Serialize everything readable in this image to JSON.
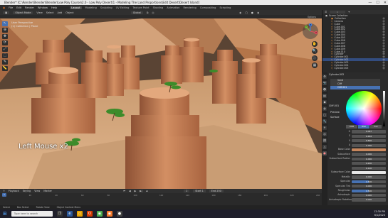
{
  "window": {
    "title": "Blender* [C:\\Render\\Blender\\Blender\\Low Poly Course\\2.0 - Low Poly Desert\\1 - Modeling The Land Proportions\\Edit Desert\\Desert Island]",
    "controls": [
      "—",
      "☐",
      "✕"
    ]
  },
  "menubar": {
    "menus": [
      "File",
      "Edit",
      "Render",
      "Window",
      "Help"
    ],
    "workspaces": [
      "Layout",
      "Modeling",
      "Sculpting",
      "UV Editing",
      "Texture Paint",
      "Shading",
      "Animation",
      "Rendering",
      "Compositing",
      "Scripting"
    ],
    "active_workspace": "Layout"
  },
  "viewport_header": {
    "mode": "Object Mode",
    "menus": [
      "View",
      "Select",
      "Add",
      "Object"
    ],
    "orientation": "Global"
  },
  "viewport_header2": {
    "items": [
      "Options"
    ]
  },
  "viewport": {
    "perspective": "User Perspective",
    "collection": "(1) Collection | Plane",
    "overlay_text": "Left Mouse x2",
    "tools": [
      "↖",
      "⊕",
      "✥",
      "⟳",
      "⤢",
      "⬚",
      "✎",
      "📏"
    ],
    "nav_buttons": [
      "✋",
      "🔍",
      "🎥",
      "▦"
    ],
    "gizmo_axes": [
      "X",
      "Y",
      "Z"
    ],
    "colors": {
      "sand": "#d8a578",
      "sky": "#4a3b30",
      "rock": "#c8875d",
      "tree": "#3c8b2a"
    }
  },
  "outliner": {
    "header": [
      "Scene Collection"
    ],
    "rows": [
      {
        "name": "Collection",
        "sel": false
      },
      {
        "name": "Camera",
        "sel": false
      },
      {
        "name": "Cube",
        "sel": false
      },
      {
        "name": "Cube.001",
        "sel": false
      },
      {
        "name": "Cube.002",
        "sel": false
      },
      {
        "name": "Cube.003",
        "sel": false
      },
      {
        "name": "Cube.004",
        "sel": false
      },
      {
        "name": "Cube.005",
        "sel": false
      },
      {
        "name": "Cube.006",
        "sel": false
      },
      {
        "name": "Cube.007",
        "sel": false
      },
      {
        "name": "Cube.008",
        "sel": false
      },
      {
        "name": "Cube.009",
        "sel": false
      },
      {
        "name": "Cube.010",
        "sel": false
      },
      {
        "name": "Cylinder",
        "sel": false
      },
      {
        "name": "Cylinder.001",
        "sel": false
      },
      {
        "name": "Cylinder.002",
        "sel": true
      },
      {
        "name": "Cylinder.003",
        "sel": false
      },
      {
        "name": "Cylinder.004",
        "sel": false
      },
      {
        "name": "Cylinder.005",
        "sel": false
      }
    ]
  },
  "properties": {
    "object_name": "Cylinder.002",
    "material_slots": [
      "Sand",
      "Cliff",
      "Cliff.001"
    ],
    "selected_slot": "Cliff.001",
    "material_name": "Cliff.001",
    "sections": [
      "Preview",
      "Surface"
    ],
    "color_modes": [
      "RGB",
      "HSV",
      "Hex"
    ],
    "active_color_mode": "HSV",
    "fields": [
      {
        "label": "H",
        "value": "0.067"
      },
      {
        "label": "S",
        "value": "0.482"
      },
      {
        "label": "V",
        "value": "0.800"
      },
      {
        "label": "A",
        "value": "1.000"
      },
      {
        "label": "Base Color",
        "value": ""
      },
      {
        "label": "Subsurface",
        "value": "0.000"
      },
      {
        "label": "Subsurface Radius",
        "value": "1.000"
      },
      {
        "label": "",
        "value": "0.200"
      },
      {
        "label": "",
        "value": "0.100"
      },
      {
        "label": "Subsurface Color",
        "value": ""
      },
      {
        "label": "Metallic",
        "value": "0.000"
      },
      {
        "label": "Specular",
        "value": "0.500"
      },
      {
        "label": "Specular Tint",
        "value": "0.000"
      },
      {
        "label": "Roughness",
        "value": "0.500"
      },
      {
        "label": "Anisotropic",
        "value": "0.000"
      },
      {
        "label": "Anisotropic Rotation",
        "value": "0.000"
      }
    ]
  },
  "timeline": {
    "menus": [
      "Playback",
      "Keying",
      "View",
      "Marker"
    ],
    "current_frame": "1",
    "start": "Start 1",
    "end": "End 250",
    "ticks": [
      "0",
      "20",
      "40",
      "60",
      "80",
      "100",
      "120",
      "140",
      "160",
      "180",
      "200",
      "220",
      "240"
    ]
  },
  "statusbar": {
    "items": [
      "Select",
      "Box Select",
      "Rotate View",
      "Object Context Menu"
    ]
  },
  "taskbar": {
    "search_placeholder": "Type here to search",
    "time": "12:30 PM",
    "date": "6/1/2020"
  }
}
